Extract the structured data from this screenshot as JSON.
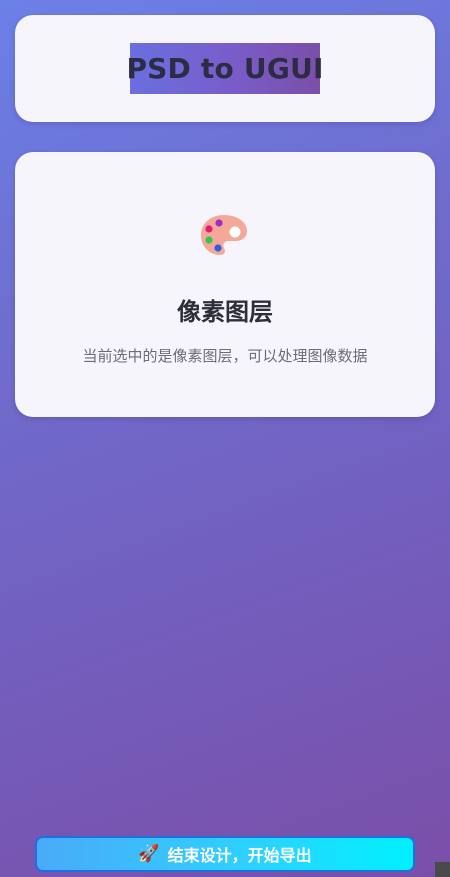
{
  "header": {
    "title": "PSD to UGUI"
  },
  "layer_info": {
    "icon": "palette-icon",
    "title": "像素图层",
    "description": "当前选中的是像素图层，可以处理图像数据"
  },
  "actions": {
    "export_icon": "rocket-icon",
    "export_label": "结束设计，开始导出"
  },
  "colors": {
    "background_start": "#6b80e8",
    "background_end": "#7a4fa8",
    "card_bg": "#f5f5fb",
    "button_start": "#4aaaf8",
    "button_end": "#00f0ff",
    "button_border": "#1f6fe0"
  }
}
